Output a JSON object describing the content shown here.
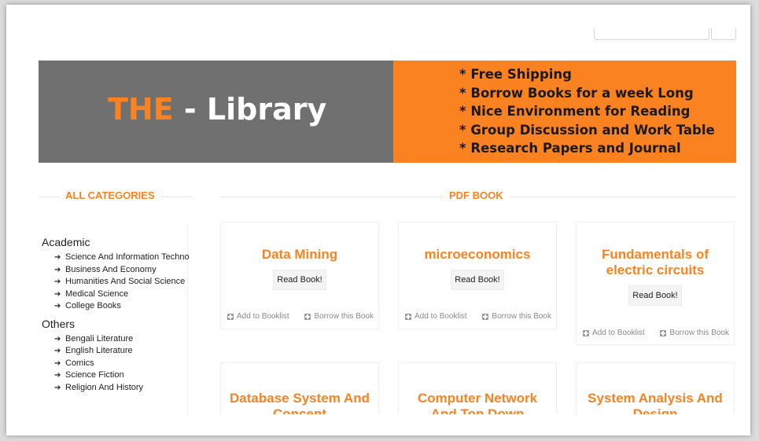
{
  "banner": {
    "logo_accent": "THE",
    "logo_rest": " - Library",
    "features": [
      "* Free Shipping",
      "* Borrow Books for a week Long",
      "* Nice Environment for Reading",
      "* Group Discussion and Work Table",
      "* Research Papers and Journal"
    ]
  },
  "sidebar": {
    "heading": "ALL CATEGORIES",
    "groups": [
      {
        "label": "Academic",
        "items": [
          "Science And Information Techno",
          "Business And Economy",
          "Humanities And Social Science",
          "Medical Science",
          "College Books"
        ]
      },
      {
        "label": "Others",
        "items": [
          "Bengali Literature",
          "English Literature",
          "Comics",
          "Science Fiction",
          "Religion And History"
        ]
      }
    ]
  },
  "main": {
    "heading": "PDF BOOK",
    "read_label": "Read Book!",
    "add_label": "Add to Booklist",
    "borrow_label": "Borrow this Book",
    "books": [
      {
        "title": "Data Mining"
      },
      {
        "title": "microeconomics"
      },
      {
        "title": "Fundamentals of electric circuits"
      },
      {
        "title": "Database System And Concept"
      },
      {
        "title": "Computer Network And Top Down Approach"
      },
      {
        "title": "System Analysis And Design"
      }
    ]
  },
  "colors": {
    "accent": "#fb8220",
    "banner_gray": "#707070"
  }
}
